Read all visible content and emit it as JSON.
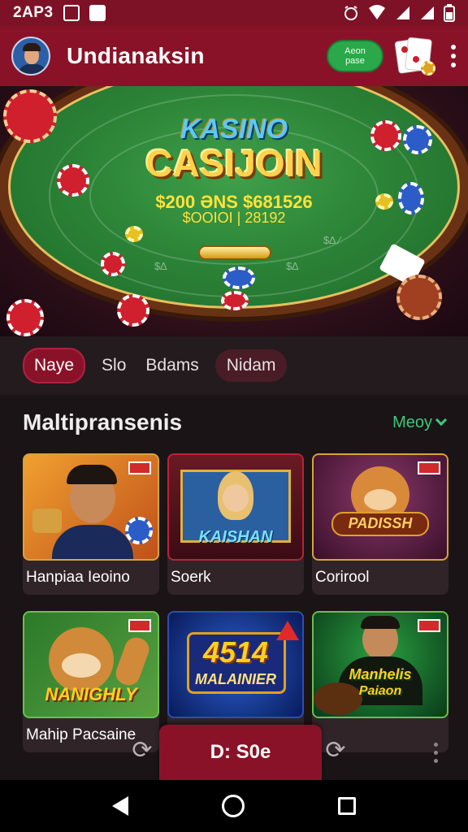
{
  "status_bar": {
    "time": "2AP3",
    "icons": [
      "notification-icon",
      "app-icon",
      "alarm-icon",
      "wifi-icon",
      "signal-icon",
      "signal-icon",
      "battery-icon"
    ]
  },
  "app_bar": {
    "title": "Undianaksin",
    "promo_line1": "Aeon",
    "promo_line2": "pase",
    "icons": [
      "avatar",
      "cards-icon",
      "more-vert-icon"
    ]
  },
  "hero": {
    "title_top": "KASINO",
    "title_main": "CASIJOIN",
    "line1": "$200 ƏNS $681526",
    "line2": "$OOIOI | 28192"
  },
  "tabs": [
    {
      "label": "Naye",
      "active": true
    },
    {
      "label": "Slo",
      "active": false
    },
    {
      "label": "Bdams",
      "active": false
    },
    {
      "label": "Nidam",
      "active": false
    }
  ],
  "section": {
    "title": "Maltipransenis",
    "more_label": "Meoy"
  },
  "games": [
    {
      "label": "Hanpiaa Ieoino",
      "art": "",
      "colors": [
        "#e0701a",
        "#f4b040"
      ]
    },
    {
      "label": "Soerk",
      "art": "KAISHAN",
      "colors": [
        "#5a1a28",
        "#c03040"
      ]
    },
    {
      "label": "Corirool",
      "art": "PADISSH",
      "colors": [
        "#4a1a3a",
        "#8a3a6a"
      ]
    },
    {
      "label": "Mahip Pacsaine",
      "art": "NANIGHLY",
      "colors": [
        "#3a8a2a",
        "#e0a020"
      ]
    },
    {
      "label": "",
      "art": "4514",
      "art2": "MALAINIER",
      "colors": [
        "#1a3a9a",
        "#2a60d0"
      ]
    },
    {
      "label": "",
      "art": "Manhelis",
      "art2": "Paiaon",
      "colors": [
        "#1a6a2a",
        "#2aa040"
      ]
    }
  ],
  "bottom_float": {
    "label": "D: S0e"
  },
  "nav_bar": {
    "icons": [
      "back-icon",
      "home-icon",
      "recents-icon"
    ]
  }
}
